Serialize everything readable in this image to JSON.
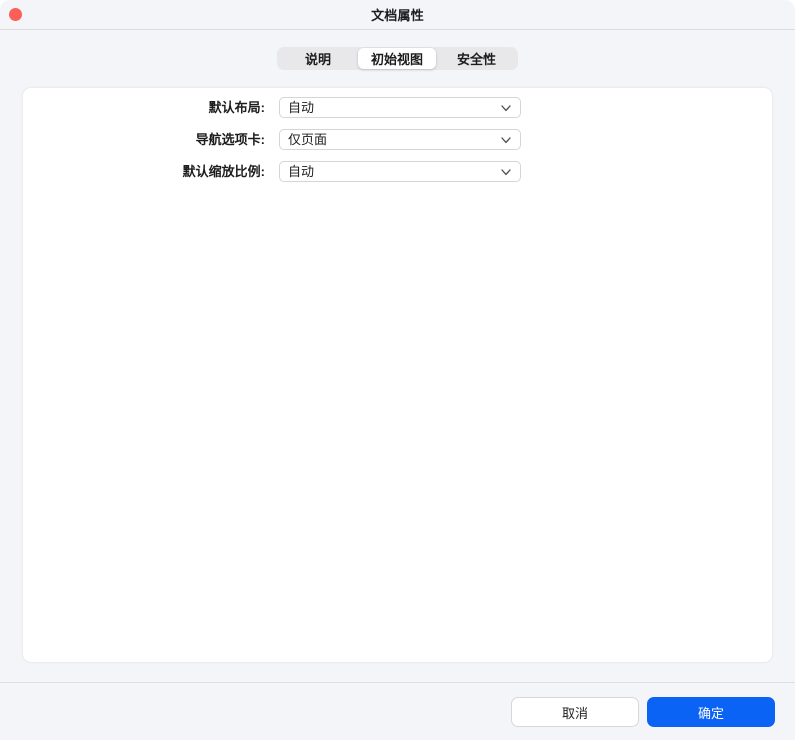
{
  "window": {
    "title": "文档属性"
  },
  "tabs": [
    {
      "label": "说明",
      "selected": false
    },
    {
      "label": "初始视图",
      "selected": true
    },
    {
      "label": "安全性",
      "selected": false
    }
  ],
  "form": {
    "fields": [
      {
        "label": "默认布局:",
        "value": "自动"
      },
      {
        "label": "导航选项卡:",
        "value": "仅页面"
      },
      {
        "label": "默认缩放比例:",
        "value": "自动"
      }
    ]
  },
  "footer": {
    "cancel_label": "取消",
    "ok_label": "确定"
  },
  "colors": {
    "accent_blue": "#0b63f5",
    "close_button_red": "#fb5f57",
    "window_background": "#f4f5f8"
  }
}
